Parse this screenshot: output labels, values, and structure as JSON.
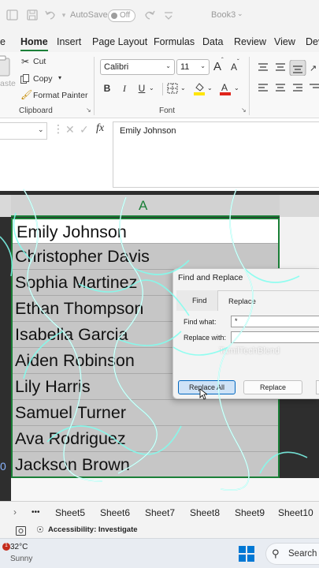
{
  "titlebar": {
    "autosave_label": "AutoSave",
    "autosave_state": "Off",
    "file_name": "Book3",
    "icons": [
      "excel-logo-icon",
      "save-icon",
      "undo-icon",
      "redo-icon"
    ]
  },
  "tabs": [
    "e",
    "Home",
    "Insert",
    "Page Layout",
    "Formulas",
    "Data",
    "Review",
    "View",
    "Dev"
  ],
  "active_tab": "Home",
  "ribbon": {
    "paste_label": "aste",
    "cut_label": "Cut",
    "copy_label": "Copy",
    "format_painter_label": "Format Painter",
    "clipboard_label": "Clipboard",
    "font_name": "Calibri",
    "font_size": "11",
    "grow_label": "A",
    "shrink_label": "A",
    "bold_label": "B",
    "italic_label": "I",
    "underline_label": "U",
    "font_label": "Font"
  },
  "formula_bar": {
    "name_box_value": "",
    "fx_label": "fx",
    "content": "Emily Johnson"
  },
  "grid": {
    "column_header": "A",
    "row_number_fragment": "0",
    "rows": [
      "Emily Johnson",
      "Christopher Davis",
      "Sophia Martinez",
      "Ethan Thompson",
      "Isabella Garcia",
      "Aiden Robinson",
      "Lily Harris",
      "Samuel Turner",
      "Ava Rodriguez",
      "Jackson Brown"
    ]
  },
  "dialog": {
    "title": "Find and Replace",
    "tab_find": "Find",
    "tab_replace": "Replace",
    "active_tab": "Replace",
    "find_what_label": "Find what:",
    "find_what_value": "*",
    "replace_with_label": "Replace with:",
    "replace_with_value": "",
    "watermark": "TamilTechBlend",
    "replace_all_label": "Replace All",
    "replace_label": "Replace"
  },
  "sheet_tabs": {
    "more_label": "•••",
    "sheets": [
      "Sheet5",
      "Sheet6",
      "Sheet7",
      "Sheet8",
      "Sheet9",
      "Sheet10"
    ]
  },
  "status": {
    "accessibility": "Accessibility: Investigate"
  },
  "taskbar": {
    "temperature": "32°C",
    "condition": "Sunny",
    "weather_badge": "1",
    "search_label": "Search"
  },
  "colors": {
    "excel_green": "#1a7f37",
    "selection_gray": "#c6c6c6",
    "accent_blue": "#0067c0"
  }
}
